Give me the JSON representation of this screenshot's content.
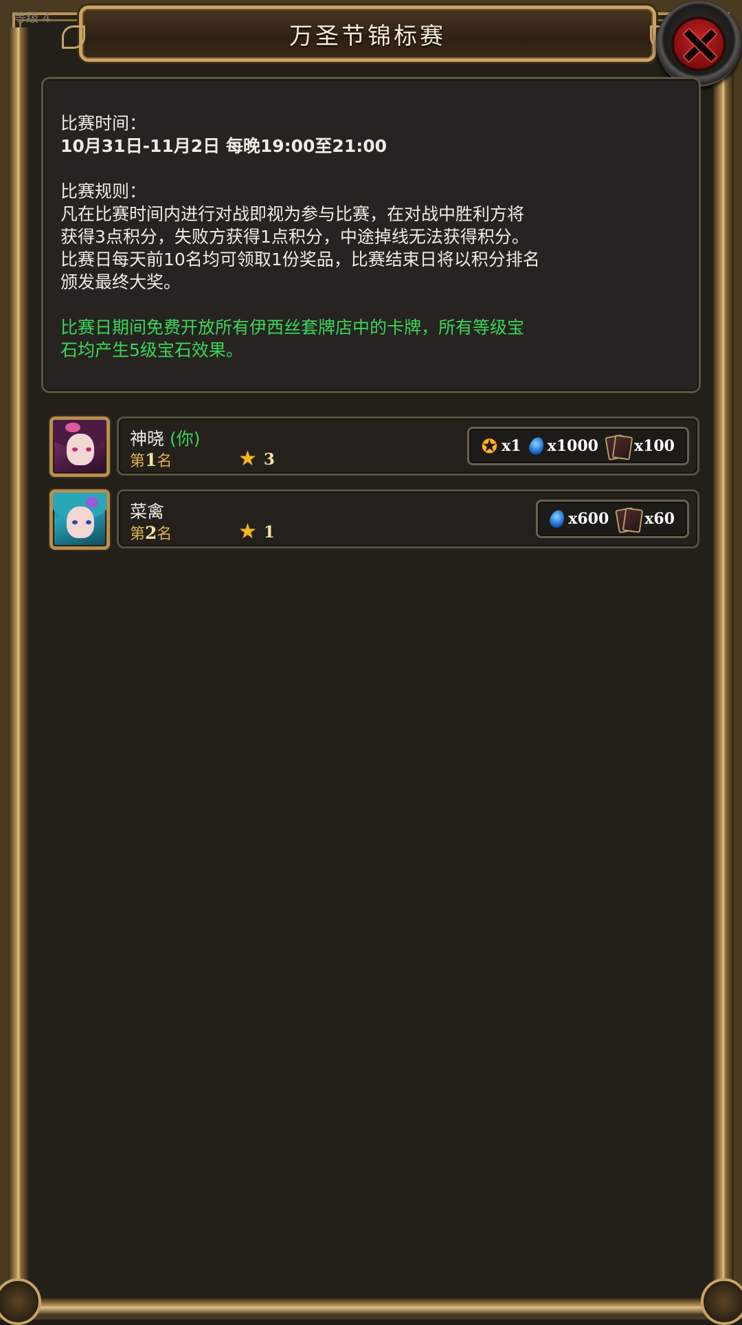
{
  "corner_text": "等级 4",
  "title": "万圣节锦标赛",
  "rules": {
    "time_heading": "比赛时间：",
    "time_value": "10月31日-11月2日 每晚19:00至21:00",
    "rules_heading": "比赛规则：",
    "rules_line1": "凡在比赛时间内进行对战即视为参与比赛，在对战中胜利方将",
    "rules_line2": "获得3点积分，失败方获得1点积分，中途掉线无法获得积分。",
    "rules_line3": "比赛日每天前10名均可领取1份奖品，比赛结束日将以积分排名",
    "rules_line4": "颁发最终大奖。",
    "free_line1": "比赛日期间免费开放所有伊西丝套牌店中的卡牌，所有等级宝",
    "free_line2": "石均产生5级宝石效果。"
  },
  "rankings": [
    {
      "name": "神晓",
      "you_tag": "(你)",
      "rank_prefix": "第",
      "rank": "1",
      "rank_suffix": "名",
      "score": "3",
      "rewards": {
        "medal": "x1",
        "gem": "x1000",
        "cards": "x100"
      }
    },
    {
      "name": "菜禽",
      "rank_prefix": "第",
      "rank": "2",
      "rank_suffix": "名",
      "score": "1",
      "rewards": {
        "gem": "x600",
        "cards": "x60"
      }
    }
  ],
  "icons": {
    "close": "close-icon",
    "star": "star-icon",
    "medal": "medal-icon",
    "gem": "gem-icon",
    "cards": "cards-icon"
  },
  "colors": {
    "accent_green": "#39d65a",
    "rank_gold": "#e0b050",
    "frame_gold": "#c9a466"
  }
}
